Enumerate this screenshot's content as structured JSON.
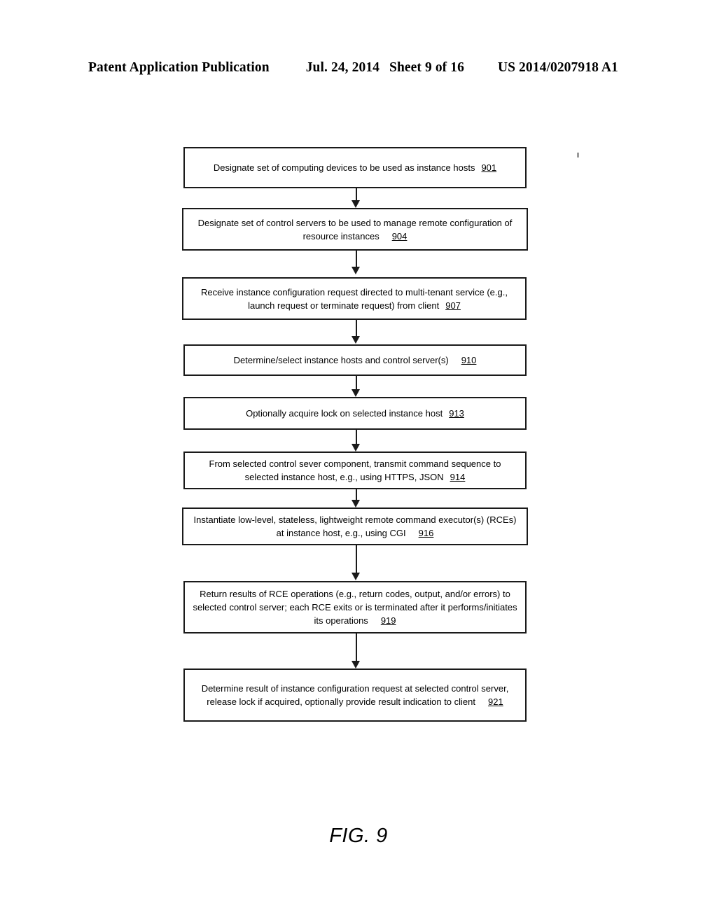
{
  "header": {
    "publication": "Patent Application Publication",
    "date": "Jul. 24, 2014",
    "sheet": "Sheet 9 of 16",
    "patent_number": "US 2014/0207918 A1"
  },
  "figure": {
    "caption": "FIG. 9",
    "type": "flowchart",
    "orientation": "vertical",
    "connector_count": 8
  },
  "flowchart": {
    "steps": [
      {
        "id": "step-901",
        "ref": "901",
        "lines": [
          "Designate set of computing devices to be used as instance hosts"
        ],
        "text": "Designate set of computing devices to be used as instance hosts 901"
      },
      {
        "id": "step-904",
        "ref": "904",
        "lines": [
          "Designate set of control servers to be used to manage remote configuration of",
          "resource instances"
        ],
        "text": "Designate set of control servers to be used to manage remote configuration of resource instances 904"
      },
      {
        "id": "step-907",
        "ref": "907",
        "lines": [
          "Receive instance configuration request directed to multi-tenant service (e.g.,",
          "launch request or terminate request) from client"
        ],
        "text": "Receive instance configuration request directed to multi-tenant service (e.g., launch request or terminate request) from client 907"
      },
      {
        "id": "step-910",
        "ref": "910",
        "lines": [
          "Determine/select instance hosts and control server(s)"
        ],
        "text": "Determine/select instance hosts and control server(s) 910"
      },
      {
        "id": "step-913",
        "ref": "913",
        "lines": [
          "Optionally acquire lock on selected instance host"
        ],
        "text": "Optionally acquire lock on selected instance host 913"
      },
      {
        "id": "step-914",
        "ref": "914",
        "lines": [
          "From selected control sever component, transmit command sequence to",
          "selected instance host, e.g., using HTTPS, JSON"
        ],
        "text": "From selected control sever component, transmit command sequence to selected instance host, e.g., using HTTPS, JSON 914"
      },
      {
        "id": "step-916",
        "ref": "916",
        "lines": [
          "Instantiate low-level, stateless, lightweight remote command executor(s) (RCEs)",
          "at instance host, e.g., using CGI"
        ],
        "text": "Instantiate low-level, stateless, lightweight remote command executor(s) (RCEs) at instance host, e.g., using CGI 916"
      },
      {
        "id": "step-919",
        "ref": "919",
        "lines": [
          "Return results of RCE operations (e.g., return codes, output, and/or errors) to",
          "selected control server; each RCE exits or is terminated after it performs/initiates",
          "its operations"
        ],
        "text": "Return results of RCE operations (e.g., return codes, output, and/or errors) to selected control server; each RCE exits or is terminated after it performs/initiates its operations 919"
      },
      {
        "id": "step-921",
        "ref": "921",
        "lines": [
          "Determine result of instance configuration request at selected control server,",
          "release lock if acquired, optionally provide result indication to client"
        ],
        "text": "Determine result of instance configuration request at selected control server, release lock if acquired, optionally provide result indication to client 921"
      }
    ]
  },
  "colors": {
    "ink": "#1a1a1a",
    "page": "#ffffff"
  }
}
